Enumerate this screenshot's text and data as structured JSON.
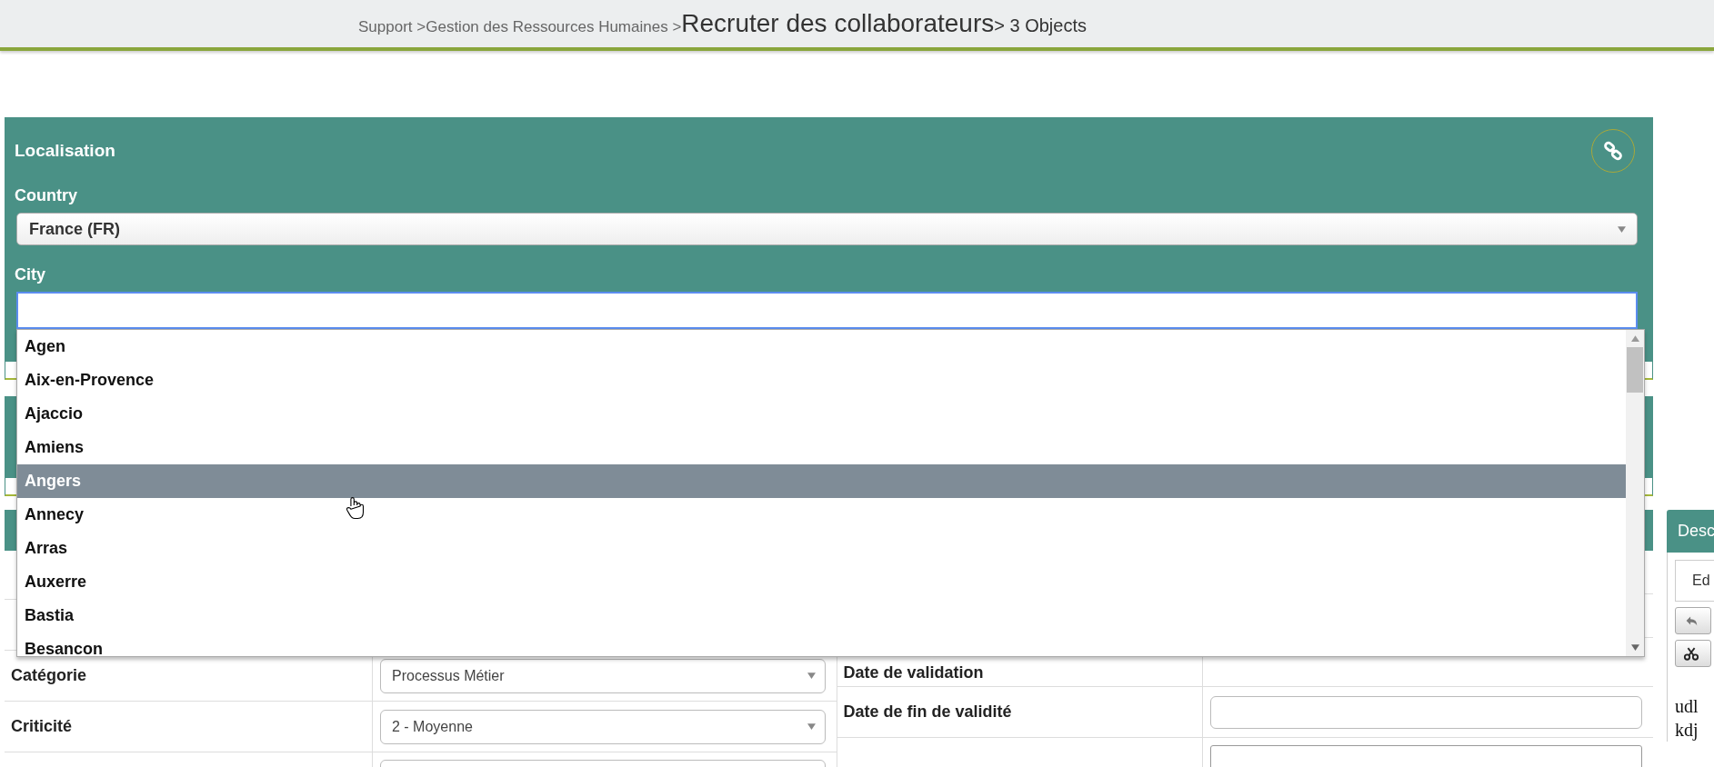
{
  "breadcrumb": [
    {
      "text": "Support >",
      "kind": "link"
    },
    {
      "text": "Gestion des Ressources Humaines >",
      "kind": "link"
    },
    {
      "text": "Recruter des collaborateurs",
      "kind": "current"
    },
    {
      "text": "> 3 Objects",
      "kind": "count"
    }
  ],
  "localisation": {
    "title": "Localisation",
    "country": {
      "label": "Country",
      "value": "France (FR)"
    },
    "city": {
      "label": "City",
      "focused": true
    }
  },
  "city_options": [
    {
      "label": "Agen",
      "selected": false
    },
    {
      "label": "Aix-en-Provence",
      "selected": false
    },
    {
      "label": "Ajaccio",
      "selected": false
    },
    {
      "label": "Amiens",
      "selected": false
    },
    {
      "label": "Angers",
      "selected": true
    },
    {
      "label": "Annecy",
      "selected": false
    },
    {
      "label": "Arras",
      "selected": false
    },
    {
      "label": "Auxerre",
      "selected": false
    },
    {
      "label": "Bastia",
      "selected": false
    },
    {
      "label": "Besancon",
      "selected": false
    }
  ],
  "form": {
    "left_rows": [
      {
        "label": "Catégorie",
        "value": "Processus Métier"
      },
      {
        "label": "Criticité",
        "value": "2 - Moyenne"
      }
    ],
    "right_rows": [
      {
        "label": "Date de validation",
        "kind": "text"
      },
      {
        "label": "Date de fin de validité",
        "kind": "input"
      },
      {
        "kind": "editor"
      }
    ]
  },
  "description_panel": {
    "title": "Desc",
    "tab": "Ed",
    "text_lines": [
      "udl",
      "kdj"
    ]
  }
}
